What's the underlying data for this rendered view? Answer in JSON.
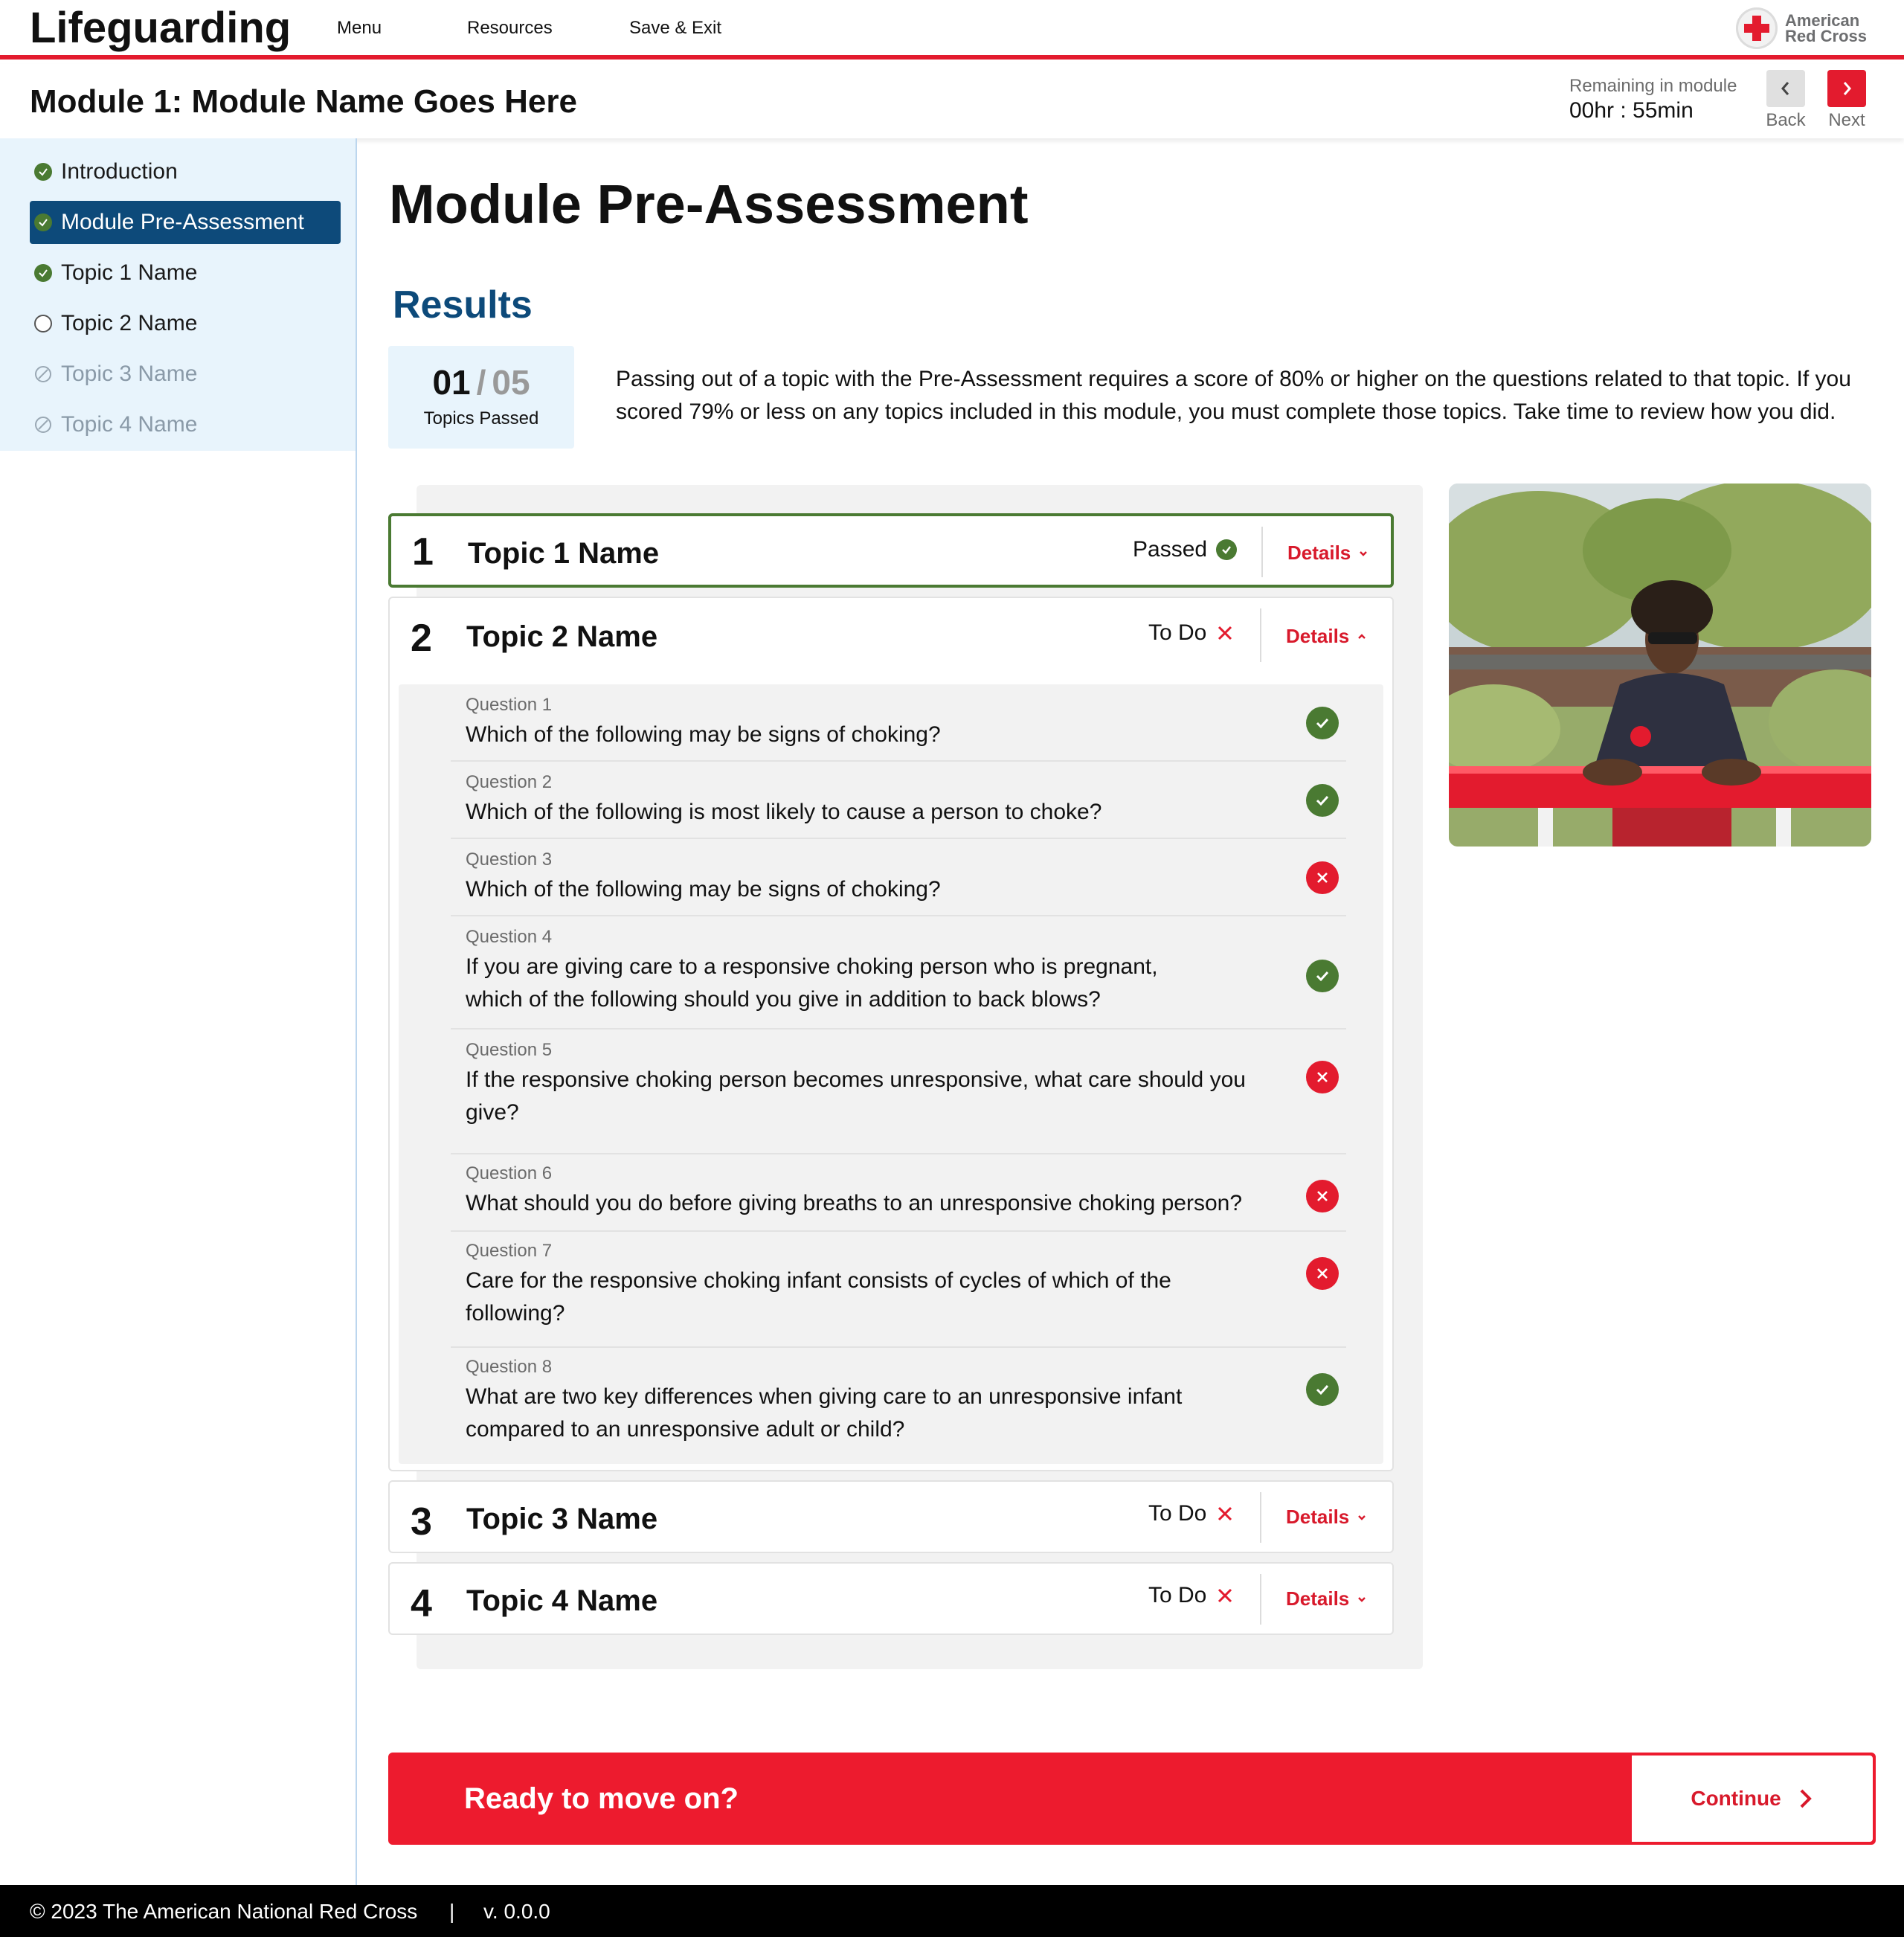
{
  "app": {
    "title": "Lifeguarding",
    "nav": [
      "Menu",
      "Resources",
      "Save & Exit"
    ],
    "logo_line1": "American",
    "logo_line2": "Red Cross"
  },
  "module": {
    "title": "Module 1: Module Name Goes Here",
    "remaining_label": "Remaining in module",
    "remaining_time": "00hr : 55min",
    "back_label": "Back",
    "next_label": "Next"
  },
  "sidebar": {
    "items": [
      {
        "label": "Introduction",
        "state": "complete"
      },
      {
        "label": "Module Pre-Assessment",
        "state": "active-complete"
      },
      {
        "label": "Topic 1 Name",
        "state": "complete"
      },
      {
        "label": "Topic 2 Name",
        "state": "incomplete"
      },
      {
        "label": "Topic 3 Name",
        "state": "locked"
      },
      {
        "label": "Topic 4 Name",
        "state": "locked"
      }
    ]
  },
  "main": {
    "page_title": "Module Pre-Assessment",
    "results_title": "Results",
    "score": {
      "passed": "01",
      "separator": "/",
      "total": "05",
      "label": "Topics Passed"
    },
    "intro": "Passing out of a topic with the Pre-Assessment requires a score of 80% or higher on the questions related to that topic. If you scored 79% or less on any topics included in this module, you must complete those topics. Take time to review how you did.",
    "details_label": "Details",
    "topics": [
      {
        "number": "1",
        "name": "Topic 1 Name",
        "status": "Passed"
      },
      {
        "number": "2",
        "name": "Topic 2 Name",
        "status": "To Do"
      },
      {
        "number": "3",
        "name": "Topic 3 Name",
        "status": "To Do"
      },
      {
        "number": "4",
        "name": "Topic 4 Name",
        "status": "To Do"
      }
    ],
    "questions": [
      {
        "label": "Question 1",
        "text": "Which of the following may be signs of choking?",
        "correct": true
      },
      {
        "label": "Question 2",
        "text": "Which of the following is most likely to cause a person to choke?",
        "correct": true
      },
      {
        "label": "Question 3",
        "text": "Which of the following may be signs of choking?",
        "correct": false
      },
      {
        "label": "Question 4",
        "text": "If you are giving care to a responsive choking person who is pregnant, which of the following should you give in addition to back blows?",
        "correct": true
      },
      {
        "label": "Question 5",
        "text": "If the responsive choking person becomes unresponsive, what care should you give?",
        "correct": false
      },
      {
        "label": "Question 6",
        "text": "What should you do before giving breaths to an unresponsive choking person?",
        "correct": false
      },
      {
        "label": "Question 7",
        "text": "Care for the responsive choking infant consists of cycles of which of the following?",
        "correct": false
      },
      {
        "label": "Question 8",
        "text": "What are two key differences when giving care to an unresponsive infant compared to an unresponsive adult or child?",
        "correct": true
      }
    ],
    "cta": {
      "text": "Ready to move on?",
      "button": "Continue"
    }
  },
  "footer": {
    "copyright": "© 2023 The American National Red Cross",
    "divider": "|",
    "version": "v. 0.0.0"
  },
  "colors": {
    "brand_red": "#ed1b2e",
    "navy": "#0d4a7a",
    "pass_green": "#4a7a32",
    "sidebar_bg": "#e8f4fc"
  }
}
